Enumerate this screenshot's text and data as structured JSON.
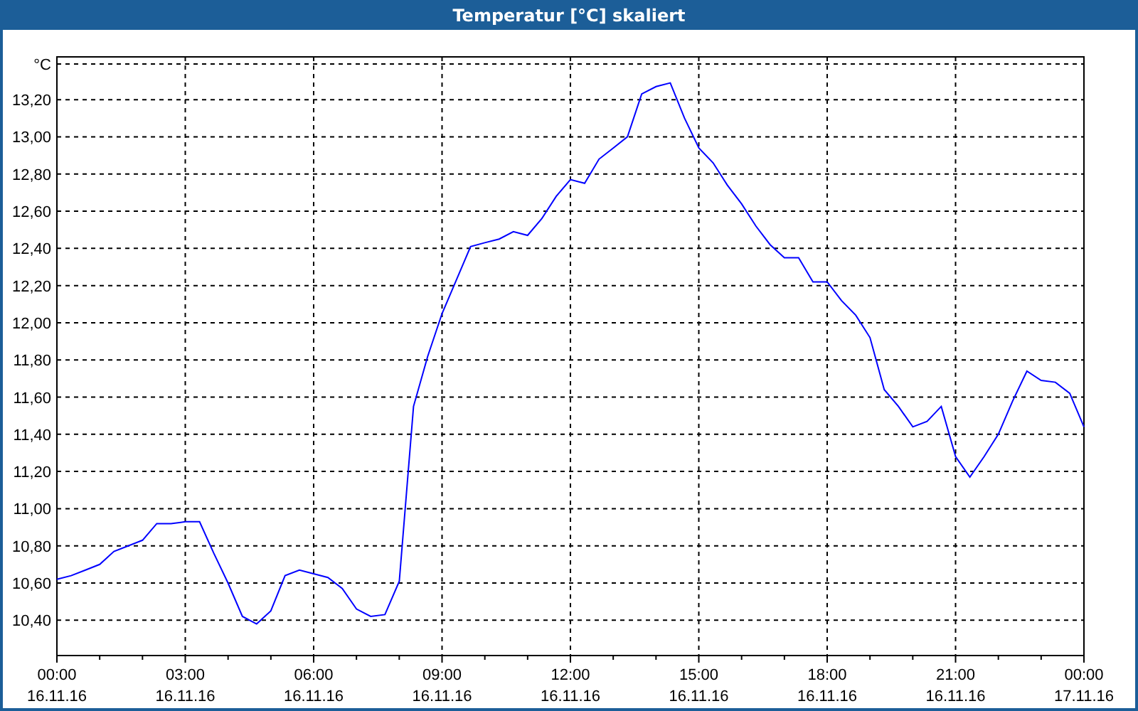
{
  "window": {
    "title": "Temperatur [°C] skaliert"
  },
  "chart": {
    "chart_data": {
      "type": "line",
      "grid": true,
      "ylabel": "°C",
      "ylim": [
        10.21,
        13.43
      ],
      "yticks": [
        {
          "value": 10.4,
          "label": "10,40"
        },
        {
          "value": 10.6,
          "label": "10,60"
        },
        {
          "value": 10.8,
          "label": "10,80"
        },
        {
          "value": 11.0,
          "label": "11,00"
        },
        {
          "value": 11.2,
          "label": "11,20"
        },
        {
          "value": 11.4,
          "label": "11,40"
        },
        {
          "value": 11.6,
          "label": "11,60"
        },
        {
          "value": 11.8,
          "label": "11,80"
        },
        {
          "value": 12.0,
          "label": "12,00"
        },
        {
          "value": 12.2,
          "label": "12,20"
        },
        {
          "value": 12.4,
          "label": "12,40"
        },
        {
          "value": 12.6,
          "label": "12,60"
        },
        {
          "value": 12.8,
          "label": "12,80"
        },
        {
          "value": 13.0,
          "label": "13,00"
        },
        {
          "value": 13.2,
          "label": "13,20"
        }
      ],
      "categories": [
        "00:00\n16.11.16",
        null,
        null,
        null,
        null,
        null,
        null,
        null,
        null,
        "03:00\n16.11.16",
        null,
        null,
        null,
        null,
        null,
        null,
        null,
        null,
        "06:00\n16.11.16",
        null,
        null,
        null,
        null,
        null,
        null,
        null,
        null,
        "09:00\n16.11.16",
        null,
        null,
        null,
        null,
        null,
        null,
        null,
        null,
        "12:00\n16.11.16",
        null,
        null,
        null,
        null,
        null,
        null,
        null,
        null,
        "15:00\n16.11.16",
        null,
        null,
        null,
        null,
        null,
        null,
        null,
        null,
        "18:00\n16.11.16",
        null,
        null,
        null,
        null,
        null,
        null,
        null,
        null,
        "21:00\n16.11.16",
        null,
        null,
        null,
        null,
        null,
        null,
        null,
        null,
        "00:00\n17.11.16"
      ],
      "series": [
        {
          "color": "#0000ff",
          "values": [
            10.62,
            10.64,
            10.67,
            10.7,
            10.77,
            10.8,
            10.83,
            10.92,
            10.92,
            10.93,
            10.93,
            10.76,
            10.6,
            10.42,
            10.38,
            10.45,
            10.64,
            10.67,
            10.65,
            10.63,
            10.57,
            10.46,
            10.42,
            10.43,
            10.61,
            11.55,
            11.82,
            12.05,
            12.23,
            12.41,
            12.43,
            12.45,
            12.49,
            12.47,
            12.56,
            12.68,
            12.77,
            12.75,
            12.88,
            12.94,
            13.0,
            13.23,
            13.27,
            13.29,
            13.1,
            12.94,
            12.86,
            12.74,
            12.64,
            12.52,
            12.42,
            12.35,
            12.35,
            12.22,
            12.22,
            12.12,
            12.04,
            11.92,
            11.64,
            11.55,
            11.44,
            11.47,
            11.55,
            11.28,
            11.17,
            11.28,
            11.4,
            11.58,
            11.74,
            11.69,
            11.68,
            11.62,
            11.44
          ]
        }
      ]
    }
  }
}
